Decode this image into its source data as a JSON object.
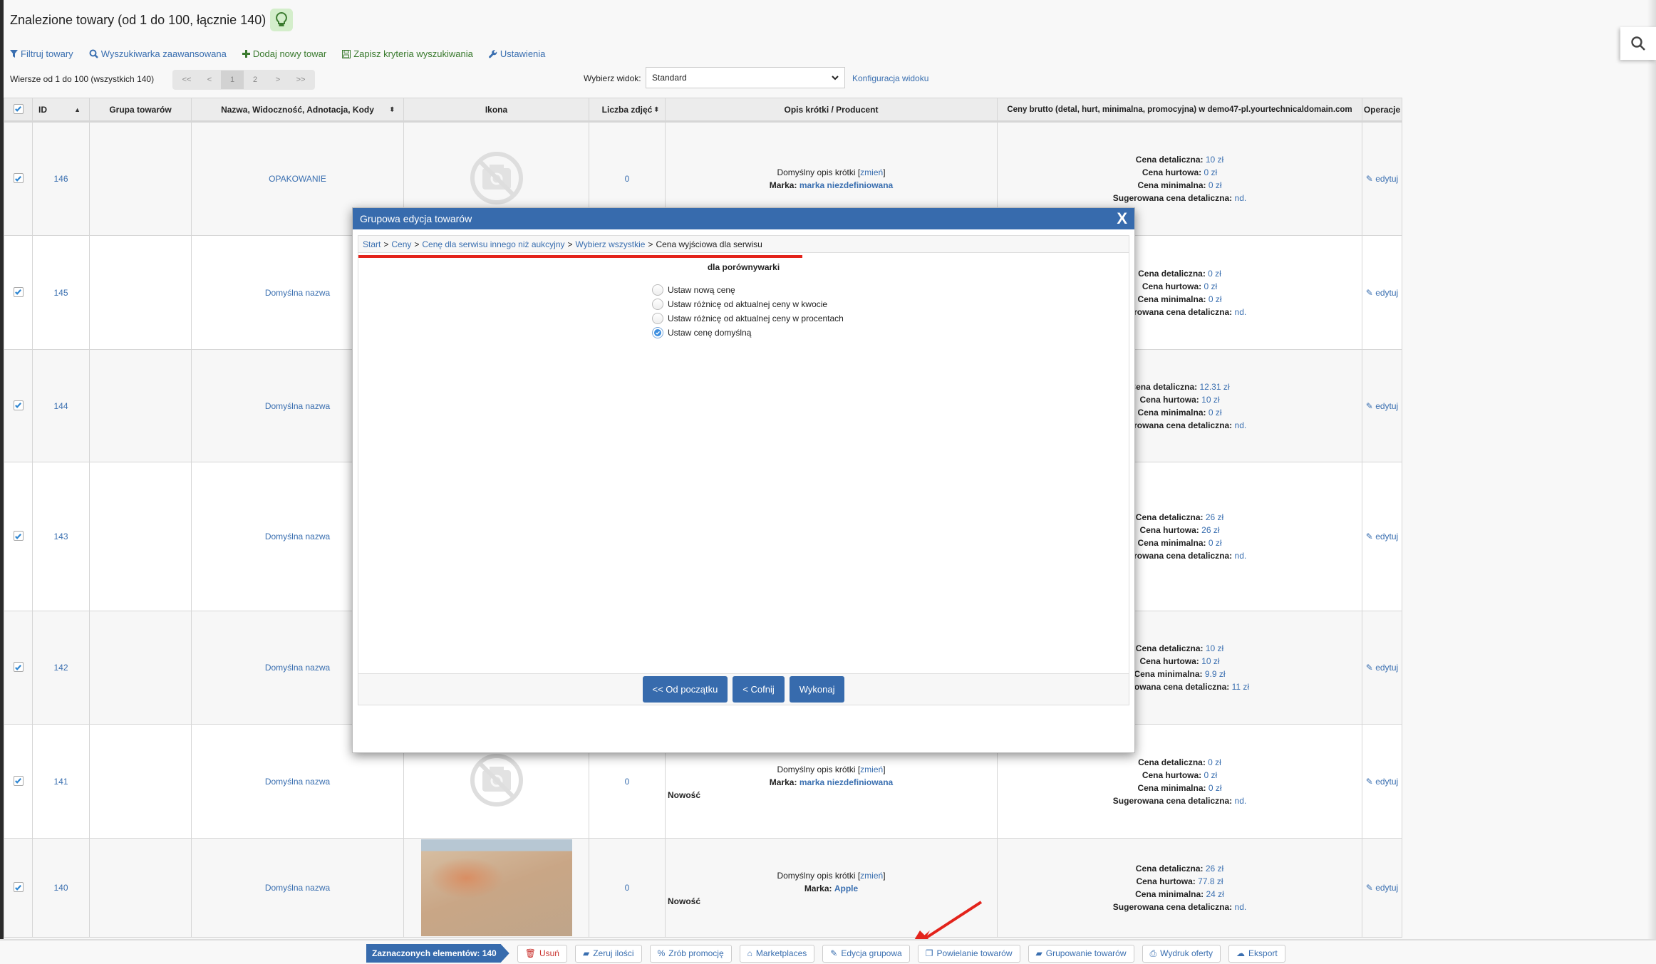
{
  "page": {
    "title": "Znalezione towary (od 1 do 100, łącznie 140)"
  },
  "toolbar": {
    "filter": "Filtruj towary",
    "advanced_search": "Wyszukiwarka zaawansowana",
    "add_product": "Dodaj nowy towar",
    "save_criteria": "Zapisz kryteria wyszukiwania",
    "settings": "Ustawienia"
  },
  "pagination": {
    "rows_info": "Wiersze od 1 do 100 (wszystkich 140)",
    "first": "<<",
    "prev": "<",
    "pages": [
      "1",
      "2"
    ],
    "current_page": "1",
    "next": ">",
    "last": ">>"
  },
  "view": {
    "label": "Wybierz widok:",
    "selected": "Standard",
    "config_link": "Konfiguracja widoku"
  },
  "table": {
    "headers": {
      "id": "ID",
      "group": "Grupa towarów",
      "name": "Nazwa, Widoczność, Adnotacja, Kody",
      "icon": "Ikona",
      "photos": "Liczba zdjęć",
      "desc": "Opis krótki / Producent",
      "prices": "Ceny brutto (detal, hurt, minimalna, promocyjna) w demo47-pl.yourtechnicaldomain.com",
      "ops": "Operacje"
    },
    "labels": {
      "retail": "Cena detaliczna:",
      "wholesale": "Cena hurtowa:",
      "minimal": "Cena minimalna:",
      "suggested": "Sugerowana cena detaliczna:",
      "desc_default": "Domyślny opis krótki",
      "change": "zmień",
      "brand": "Marka:",
      "edit": "edytuj",
      "new": "Nowość"
    },
    "rows": [
      {
        "id": "146",
        "name": "OPAKOWANIE",
        "photos": "0",
        "brand": "marka niezdefiniowana",
        "new": false,
        "image": "none",
        "retail": "10 zł",
        "wholesale": "0 zł",
        "minimal": "0 zł",
        "suggested": "nd."
      },
      {
        "id": "145",
        "name": "Domyślna nazwa",
        "photos": "",
        "brand": "",
        "new": false,
        "image": "hidden",
        "retail": "0 zł",
        "wholesale": "0 zł",
        "minimal": "0 zł",
        "suggested": "nd."
      },
      {
        "id": "144",
        "name": "Domyślna nazwa",
        "photos": "",
        "brand": "",
        "new": false,
        "image": "hidden",
        "retail": "12.31 zł",
        "wholesale": "10 zł",
        "minimal": "0 zł",
        "suggested": "nd."
      },
      {
        "id": "143",
        "name": "Domyślna nazwa",
        "photos": "",
        "brand": "",
        "new": false,
        "image": "hidden",
        "retail": "26 zł",
        "wholesale": "26 zł",
        "minimal": "0 zł",
        "suggested": "nd."
      },
      {
        "id": "142",
        "name": "Domyślna nazwa",
        "photos": "",
        "brand": "",
        "new": false,
        "image": "hidden",
        "retail": "10 zł",
        "wholesale": "10 zł",
        "minimal": "9.9 zł",
        "suggested": "11 zł"
      },
      {
        "id": "141",
        "name": "Domyślna nazwa",
        "photos": "0",
        "brand": "marka niezdefiniowana",
        "new": true,
        "image": "none",
        "retail": "0 zł",
        "wholesale": "0 zł",
        "minimal": "0 zł",
        "suggested": "nd."
      },
      {
        "id": "140",
        "name": "Domyślna nazwa",
        "photos": "0",
        "brand": "Apple",
        "new": true,
        "image": "photo",
        "retail": "26 zł",
        "wholesale": "77.8 zł",
        "minimal": "24 zł",
        "suggested": "nd."
      }
    ]
  },
  "modal": {
    "title": "Grupowa edycja towarów",
    "close": "X",
    "breadcrumb": [
      {
        "label": "Start",
        "link": true
      },
      {
        "label": "Ceny",
        "link": true
      },
      {
        "label": "Cenę dla serwisu innego niż aukcyjny",
        "link": true
      },
      {
        "label": "Wybierz wszystkie",
        "link": true
      },
      {
        "label": "Cena wyjściowa dla serwisu",
        "link": false
      }
    ],
    "subtitle": "dla porównywarki",
    "options": [
      {
        "label": "Ustaw nową cenę",
        "checked": false
      },
      {
        "label": "Ustaw różnicę od aktualnej ceny w kwocie",
        "checked": false
      },
      {
        "label": "Ustaw różnicę od aktualnej ceny w procentach",
        "checked": false
      },
      {
        "label": "Ustaw cenę domyślną",
        "checked": true
      }
    ],
    "buttons": {
      "start": "<< Od początku",
      "back": "< Cofnij",
      "execute": "Wykonaj"
    }
  },
  "bottombar": {
    "selected_count": "Zaznaczonych elementów: 140",
    "buttons": [
      {
        "label": "Usuń",
        "icon": "trash-icon"
      },
      {
        "label": "Zeruj ilości",
        "icon": "eraser-icon"
      },
      {
        "label": "Zrób promocję",
        "icon": "percent-icon"
      },
      {
        "label": "Marketplaces",
        "icon": "basket-icon"
      },
      {
        "label": "Edycja grupowa",
        "icon": "edit-icon"
      },
      {
        "label": "Powielanie towarów",
        "icon": "copy-icon"
      },
      {
        "label": "Grupowanie towarów",
        "icon": "folder-icon"
      },
      {
        "label": "Wydruk oferty",
        "icon": "print-icon"
      },
      {
        "label": "Eksport",
        "icon": "cloud-download-icon"
      }
    ]
  },
  "colors": {
    "accent": "#376bad",
    "link": "#3a6fb0",
    "annotation_red": "#e3231b"
  }
}
